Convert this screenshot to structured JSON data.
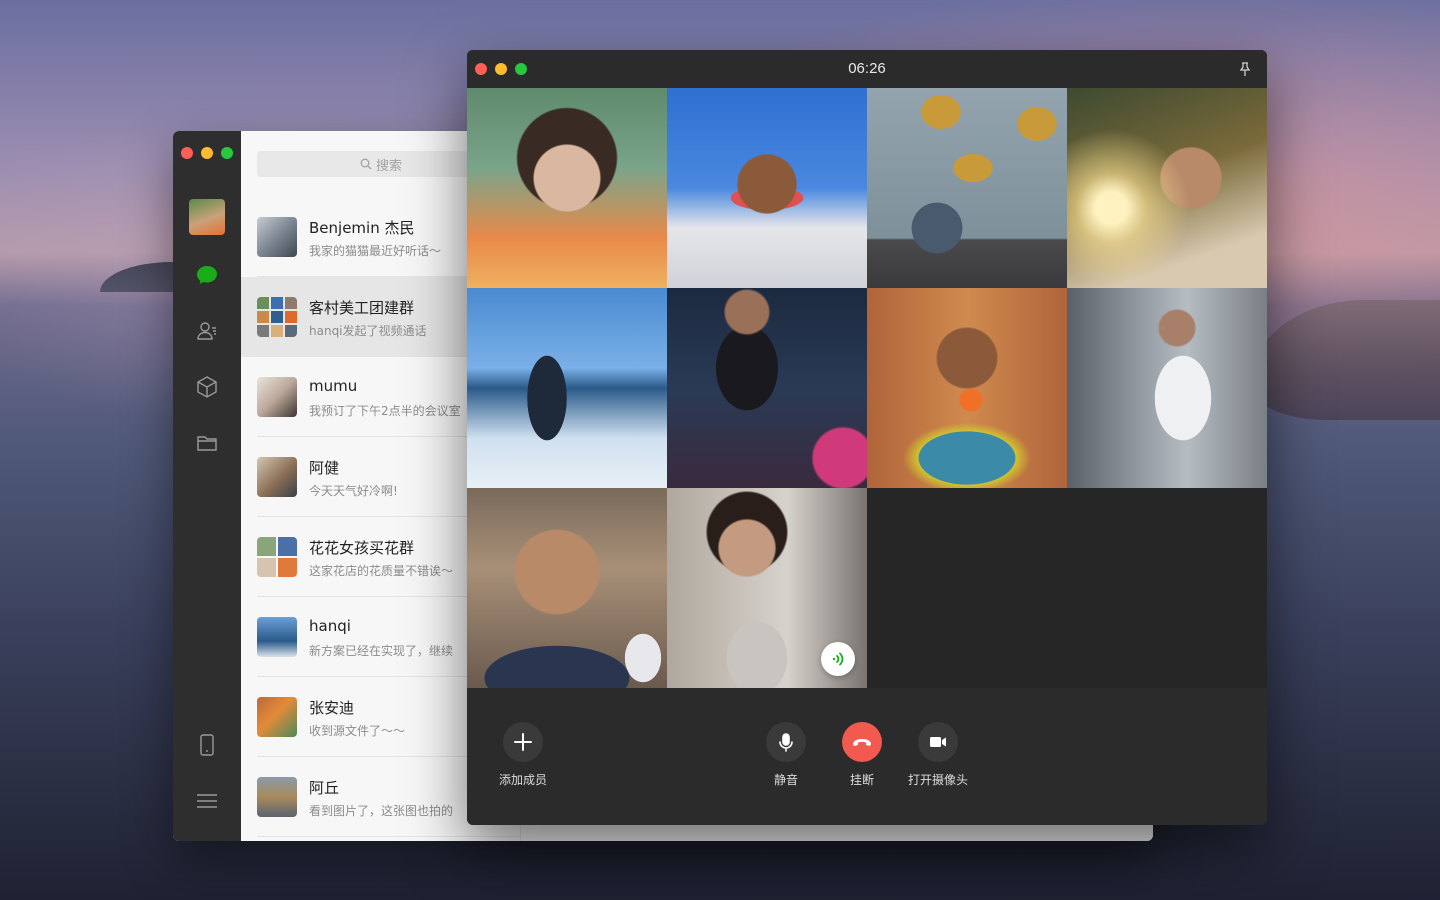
{
  "wechat": {
    "search_placeholder": "搜索",
    "chats": [
      {
        "name": "Benjemin 杰民",
        "message": "我家的猫猫最近好听话～"
      },
      {
        "name": "客村美工团建群",
        "message": "hanqi发起了视频通话"
      },
      {
        "name": "mumu",
        "message": "我预订了下午2点半的会议室"
      },
      {
        "name": "阿健",
        "message": "今天天气好冷啊!"
      },
      {
        "name": "花花女孩买花群",
        "message": "这家花店的花质量不错诶～"
      },
      {
        "name": "hanqi",
        "message": "新方案已经在实现了，继续"
      },
      {
        "name": "张安迪",
        "message": "收到源文件了～～"
      },
      {
        "name": "阿丘",
        "message": "看到图片了，这张图也拍的"
      }
    ],
    "sidebar_icons": [
      "avatar",
      "chat-icon",
      "contacts-icon",
      "box-icon",
      "folder-icon",
      "phone-icon",
      "menu-icon"
    ]
  },
  "call": {
    "timer": "06:26",
    "participants_count": 10,
    "controls": {
      "add_member": "添加成员",
      "mute": "静音",
      "hangup": "挂断",
      "camera": "打开摄像头"
    },
    "colors": {
      "hangup": "#f25a4f",
      "speaking": "#1aad19"
    }
  }
}
